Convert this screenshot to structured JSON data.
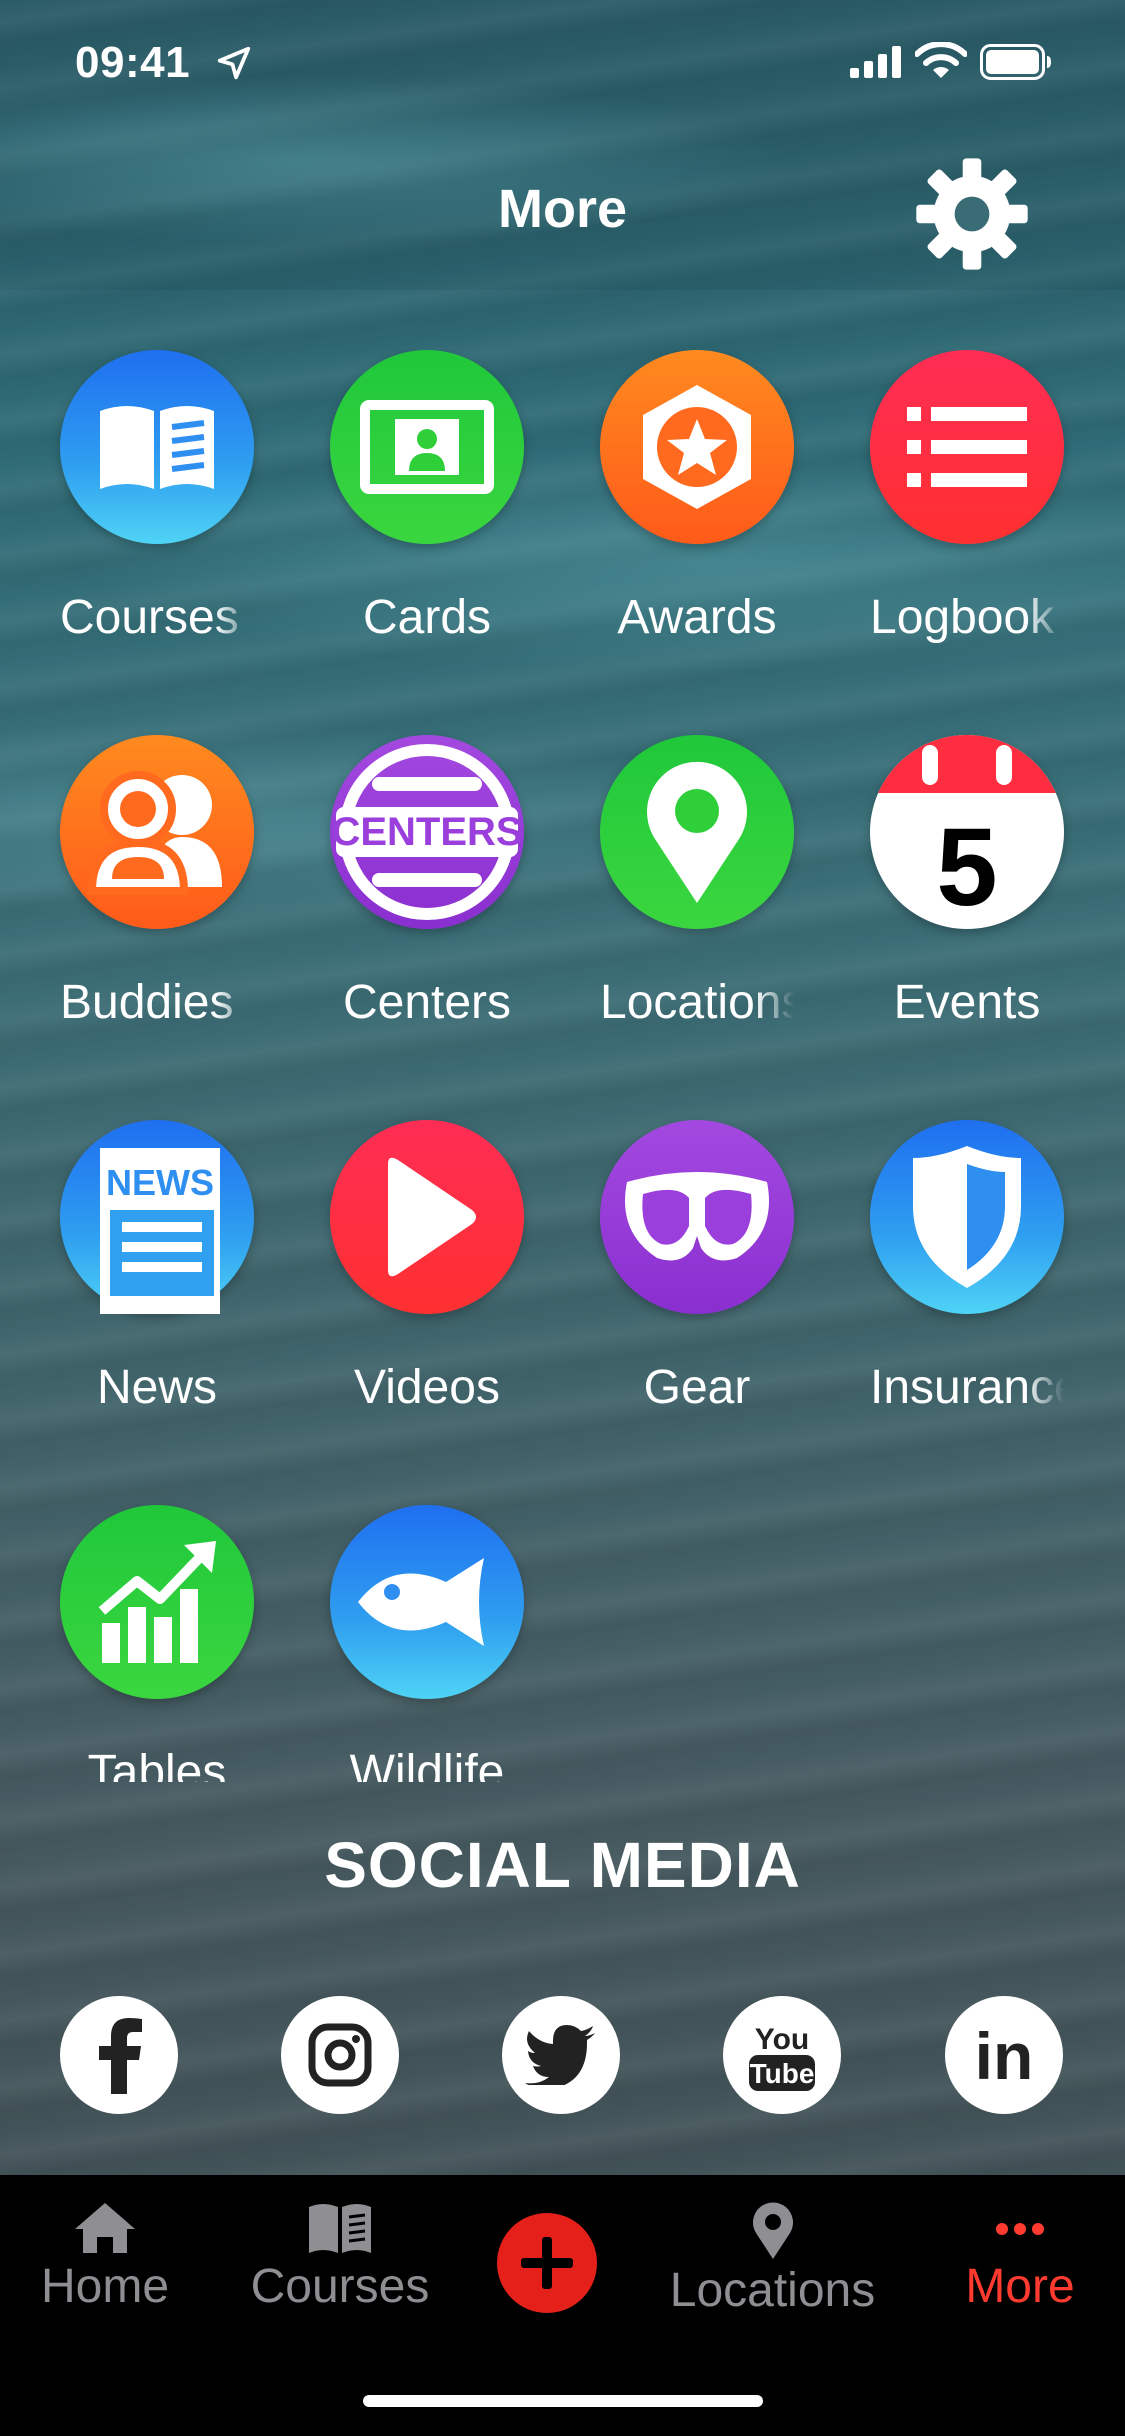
{
  "status_bar": {
    "time": "09:41"
  },
  "header": {
    "title": "More"
  },
  "grid_items": [
    {
      "label": "Courses",
      "icon": "open-book-icon",
      "color": "#2f8ff0"
    },
    {
      "label": "Cards",
      "icon": "id-card-icon",
      "color": "#2fcf3a"
    },
    {
      "label": "Awards",
      "icon": "star-badge-icon",
      "color": "#ff6a1f"
    },
    {
      "label": "Logbook",
      "icon": "list-icon",
      "color": "#ff2d40"
    },
    {
      "label": "Buddies",
      "icon": "buddies-icon",
      "color": "#ff6a1f"
    },
    {
      "label": "Centers",
      "icon": "centers-badge-icon",
      "color": "#9b3fdc"
    },
    {
      "label": "Locations",
      "icon": "map-pin-icon",
      "color": "#2fcf3a"
    },
    {
      "label": "Events",
      "icon": "calendar-icon",
      "day": "5",
      "color": "#ff2d40"
    },
    {
      "label": "News",
      "icon": "newspaper-icon",
      "badge": "NEWS",
      "color": "#2f8ff0"
    },
    {
      "label": "Videos",
      "icon": "play-icon",
      "color": "#ff2d40"
    },
    {
      "label": "Gear",
      "icon": "dive-mask-icon",
      "color": "#9b3fdc"
    },
    {
      "label": "Insurance",
      "icon": "shield-icon",
      "color": "#2f8ff0"
    },
    {
      "label": "Tables",
      "icon": "chart-up-icon",
      "color": "#2fcf3a"
    },
    {
      "label": "Wildlife",
      "icon": "fish-icon",
      "color": "#2f8ff0"
    }
  ],
  "centers_badge_text": "CENTERS",
  "social": {
    "title": "SOCIAL MEDIA",
    "youtube_top": "You",
    "youtube_bottom": "Tube",
    "linkedin": "in"
  },
  "tabbar": {
    "home": "Home",
    "courses": "Courses",
    "locations": "Locations",
    "more": "More",
    "active_color": "#ff3b30",
    "inactive_color": "#8e8e93"
  }
}
